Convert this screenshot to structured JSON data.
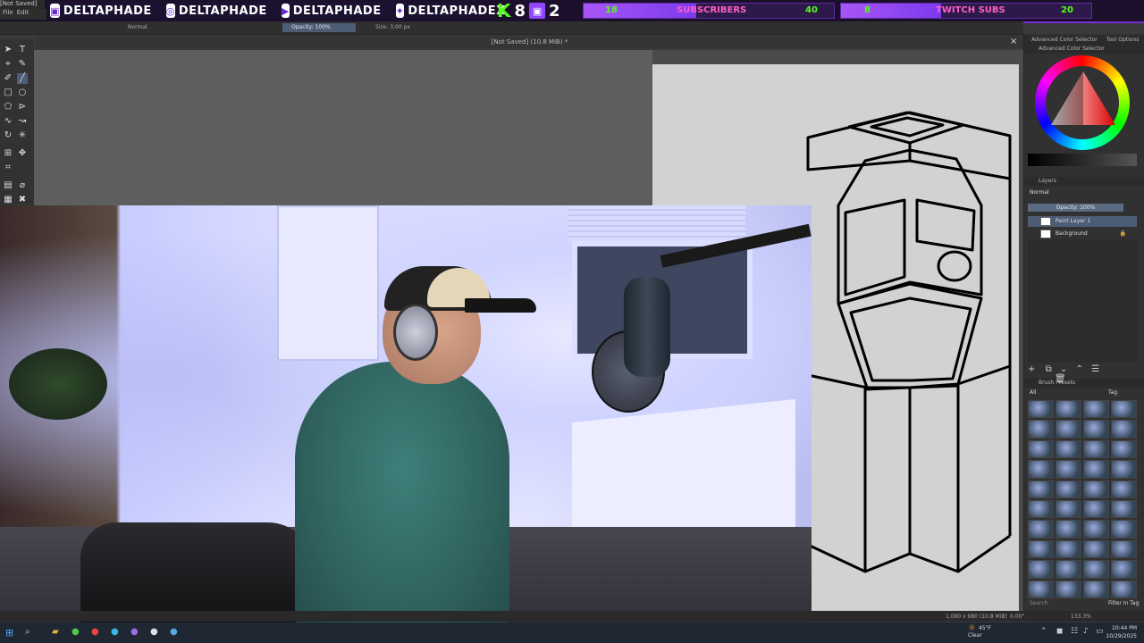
{
  "overlay": {
    "handle_1": "DELTAPHADE",
    "handle_2": "DELTAPHADE",
    "handle_3": "DELTAPHADE",
    "handle_4": "DELTAPHADEX",
    "kick_count": "8",
    "twitch_count": "2",
    "subs_goal": {
      "current": "18",
      "label": "SUBSCRIBERS",
      "target": "40",
      "progress": 0.45
    },
    "twitch_goal": {
      "current": "8",
      "label": "TWITCH SUBS",
      "target": "20",
      "progress": 0.4
    },
    "accent": "#7a2bd6",
    "kick_green": "#53fc18"
  },
  "krita": {
    "window_title": "[Not Saved]",
    "menu": [
      "File",
      "Edit"
    ],
    "blend_mode": "Normal",
    "opacity_label": "Opacity: 100%",
    "size_label": "Size: 3.00 px",
    "document_title": "[Not Saved]  (10.8 MiB) *",
    "close": "×",
    "panels": {
      "advanced_color_selector": "Advanced Color Selector",
      "tool_options": "Tool Options",
      "layers": "Layers",
      "layer_blend": "Normal",
      "layer_opacity": "Opacity: 100%",
      "layer_items": [
        "Paint Layer 1",
        "Background"
      ],
      "brush_presets": "Brush Presets",
      "brush_filter": "All",
      "brush_tag": "Tag",
      "search_placeholder": "Search",
      "filter_in_tag": "Filter in Tag"
    },
    "status": {
      "dimensions": "1,080 x 980 (10.8 MiB)",
      "rotation": "0.00°",
      "zoom": "133.3%"
    }
  },
  "taskbar": {
    "weather_temp": "45°F",
    "weather_desc": "Clear",
    "time": "10:44 PM",
    "date": "10/29/2025"
  }
}
